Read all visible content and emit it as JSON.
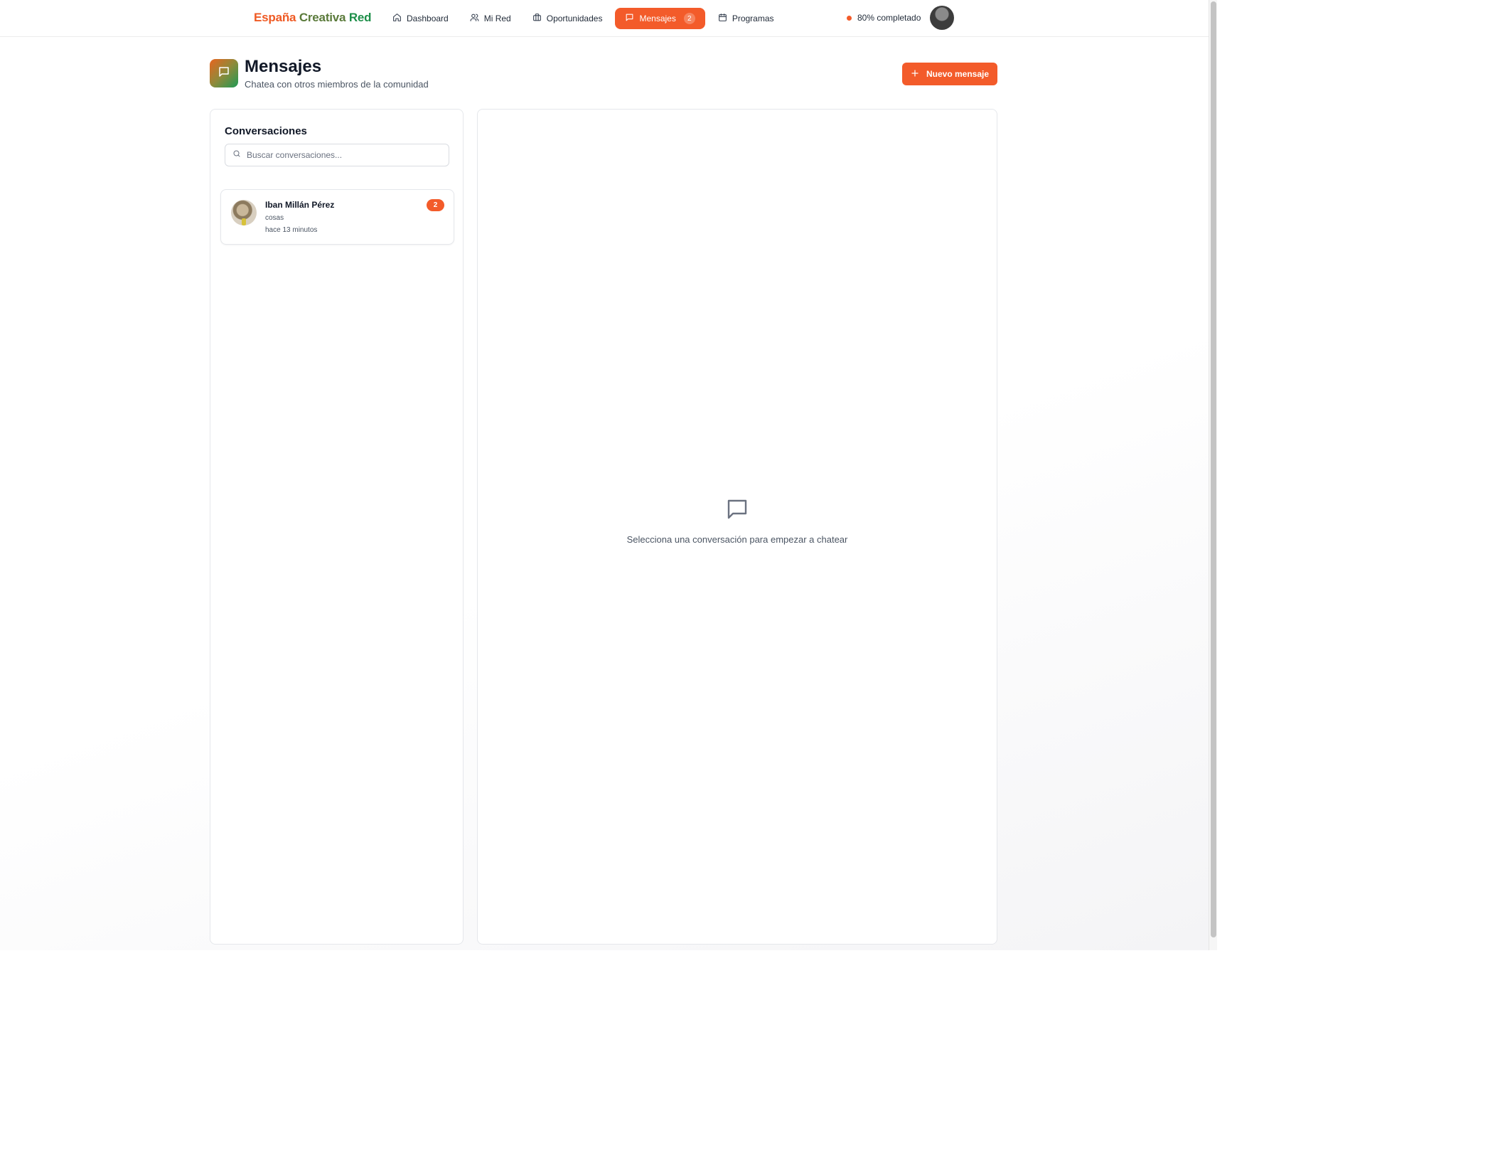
{
  "brand": {
    "part1": "España",
    "part2": "Creativa",
    "part3": "Red"
  },
  "nav": {
    "items": [
      {
        "label": "Dashboard",
        "icon": "home-icon"
      },
      {
        "label": "Mi Red",
        "icon": "users-icon"
      },
      {
        "label": "Oportunidades",
        "icon": "briefcase-icon"
      },
      {
        "label": "Mensajes",
        "icon": "message-icon",
        "count": "2",
        "active": true
      },
      {
        "label": "Programas",
        "icon": "calendar-icon"
      }
    ],
    "profile_progress": "80% completado"
  },
  "header": {
    "title": "Mensajes",
    "subtitle": "Chatea con otros miembros de la comunidad",
    "new_button": "Nuevo mensaje"
  },
  "conversations": {
    "title": "Conversaciones",
    "search_placeholder": "Buscar conversaciones...",
    "items": [
      {
        "name": "Iban Millán Pérez",
        "preview": "cosas",
        "time": "hace 13 minutos",
        "unread": "2"
      }
    ]
  },
  "chat": {
    "empty_text": "Selecciona una conversación para empezar a chatear"
  },
  "colors": {
    "accent": "#f35b2a",
    "brand_orange": "#ef5a24",
    "brand_green": "#1e8f4a"
  }
}
